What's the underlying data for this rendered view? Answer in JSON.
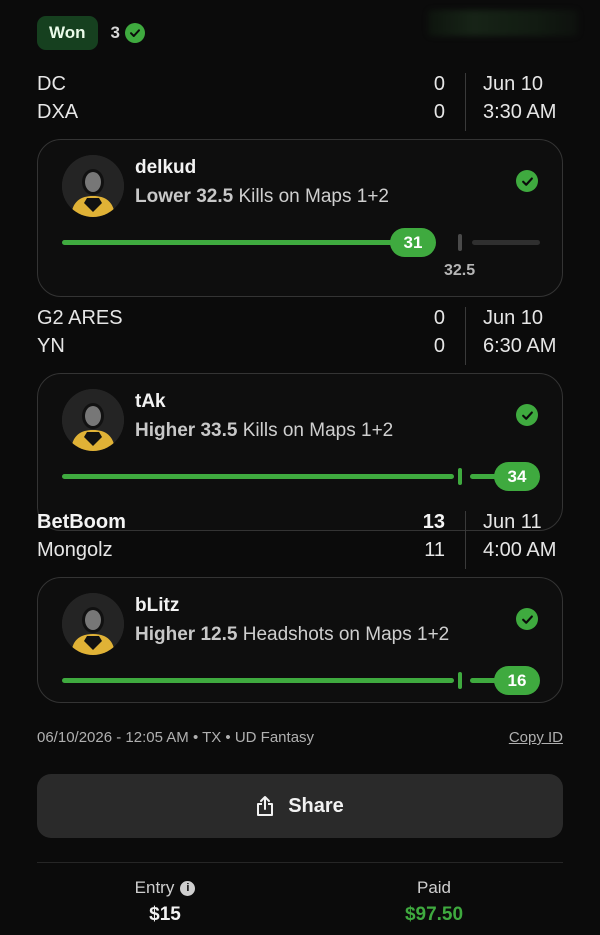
{
  "header": {
    "result_badge": "Won",
    "picks_count": "3"
  },
  "games": [
    {
      "team1": {
        "name": "DC",
        "score": "0"
      },
      "team2": {
        "name": "DXA",
        "score": "0"
      },
      "date": "Jun 10",
      "time": "3:30 AM",
      "pick": {
        "player": "delkud",
        "direction": "Lower",
        "line": "32.5",
        "stat": "Kills on Maps 1+2",
        "result_value": "31",
        "target_label": "32.5",
        "status_icon": "check-circle-icon"
      }
    },
    {
      "team1": {
        "name": "G2 ARES",
        "score": "0"
      },
      "team2": {
        "name": "YN",
        "score": "0"
      },
      "date": "Jun 10",
      "time": "6:30 AM",
      "pick": {
        "player": "tAk",
        "direction": "Higher",
        "line": "33.5",
        "stat": "Kills on Maps 1+2",
        "result_value": "34",
        "status_icon": "check-circle-icon"
      }
    },
    {
      "team1": {
        "name": "BetBoom",
        "score": "13"
      },
      "team2": {
        "name": "Mongolz",
        "score": "11"
      },
      "date": "Jun 11",
      "time": "4:00 AM",
      "pick": {
        "player": "bLitz",
        "direction": "Higher",
        "line": "12.5",
        "stat": "Headshots on Maps 1+2",
        "result_value": "16",
        "status_icon": "check-circle-icon"
      }
    }
  ],
  "meta": {
    "timestamp": "06/10/2026 - 12:05 AM • TX • UD Fantasy",
    "copy_id": "Copy ID"
  },
  "share": {
    "label": "Share",
    "icon": "share-icon"
  },
  "summary": {
    "entry_label": "Entry",
    "entry_value": "$15",
    "paid_label": "Paid",
    "paid_value": "$97.50"
  },
  "colors": {
    "accent_green": "#3faa3f",
    "badge_bg": "#16401f",
    "background": "#0b0b0b",
    "card_border": "#343434"
  }
}
